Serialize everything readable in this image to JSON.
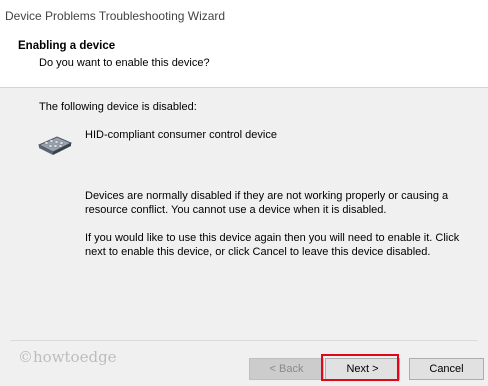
{
  "window": {
    "title": "Device Problems Troubleshooting Wizard"
  },
  "header": {
    "title": "Enabling a device",
    "subtitle": "Do you want to enable this device?"
  },
  "content": {
    "lead": "The following device is disabled:",
    "device_name": "HID-compliant consumer control device",
    "device_icon": "hid-device-icon",
    "paragraph1": "Devices are normally disabled if they are not working properly or causing a resource conflict. You cannot use a device when it is disabled.",
    "paragraph2": "If you would like to use this device again then you will need to enable it. Click next to enable this device, or click Cancel to leave this device disabled."
  },
  "watermark": "©howtoedge",
  "buttons": {
    "back_label": "< Back",
    "next_label": "Next >",
    "cancel_label": "Cancel"
  },
  "colors": {
    "highlight": "#e2061a",
    "header_bg": "#ffffff",
    "body_bg": "#f0f0f0"
  }
}
